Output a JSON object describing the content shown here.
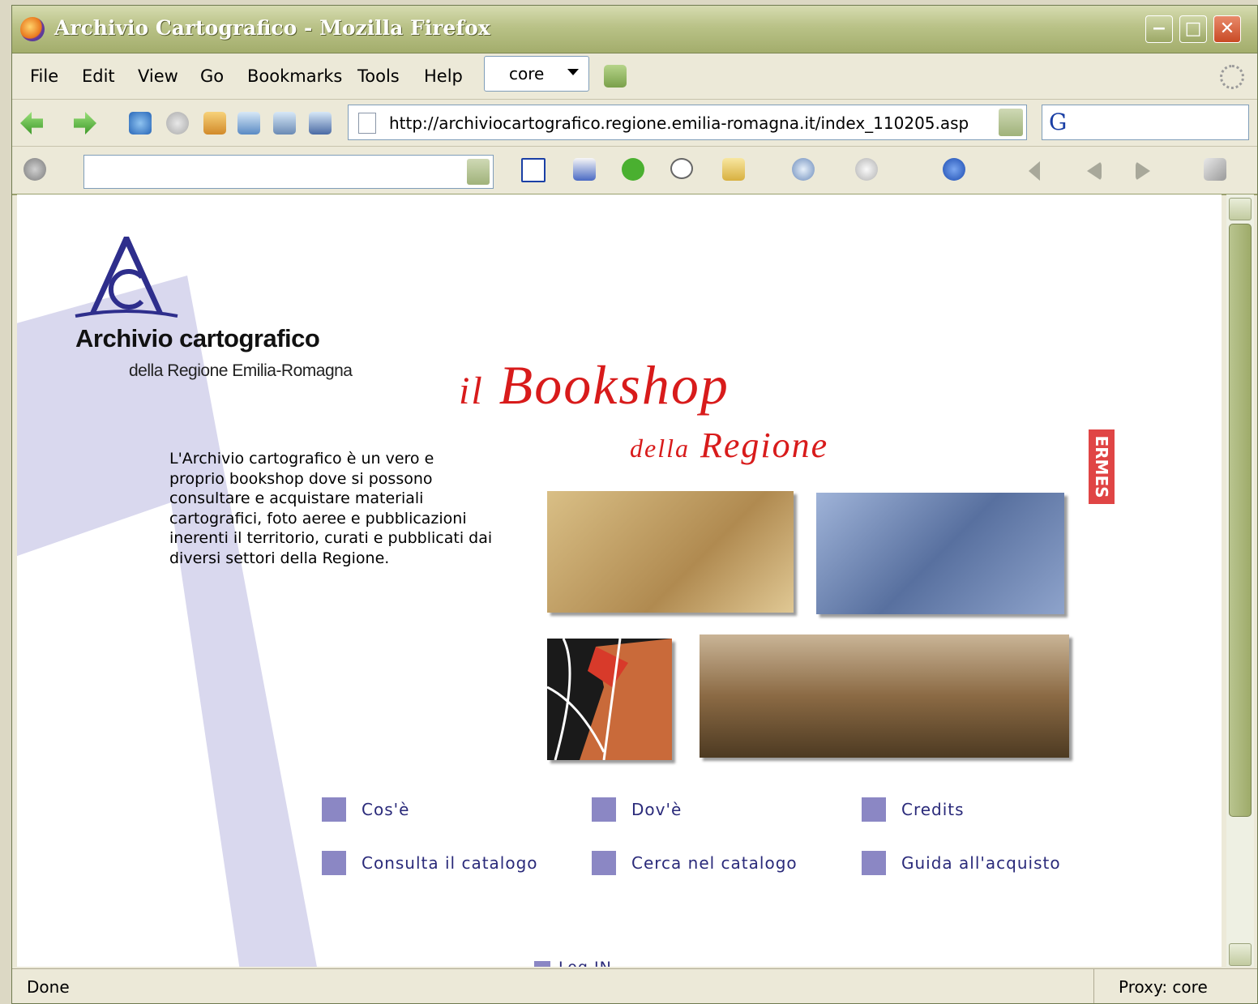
{
  "window": {
    "title": "Archivio Cartografico - Mozilla Firefox"
  },
  "menu": [
    "File",
    "Edit",
    "View",
    "Go",
    "Bookmarks",
    "Tools",
    "Help"
  ],
  "profile_select": {
    "value": "core"
  },
  "address_bar": {
    "url": "http://archiviocartografico.regione.emilia-romagna.it/index_110205.asp"
  },
  "google_search": {
    "value": ""
  },
  "page": {
    "logo_title": "Archivio cartografico",
    "logo_subtitle": "della Regione Emilia-Romagna",
    "headline_small": "il",
    "headline_big": "Bookshop",
    "subheadline_small": "della",
    "subheadline_big": "Regione",
    "ermes_logo": "ERMES",
    "description": "L'Archivio cartografico è un vero e proprio bookshop dove si possono consultare e acquistare materiali cartografici, foto aeree e pubblicazioni inerenti il territorio, curati e pubblicati dai diversi settori della Regione.",
    "links": [
      "Cos'è",
      "Dov'è",
      "Credits",
      "Consulta il catalogo",
      "Cerca nel catalogo",
      "Guida all'acquisto"
    ],
    "login": "Log IN"
  },
  "status": {
    "left": "Done",
    "proxy": "Proxy: core"
  }
}
